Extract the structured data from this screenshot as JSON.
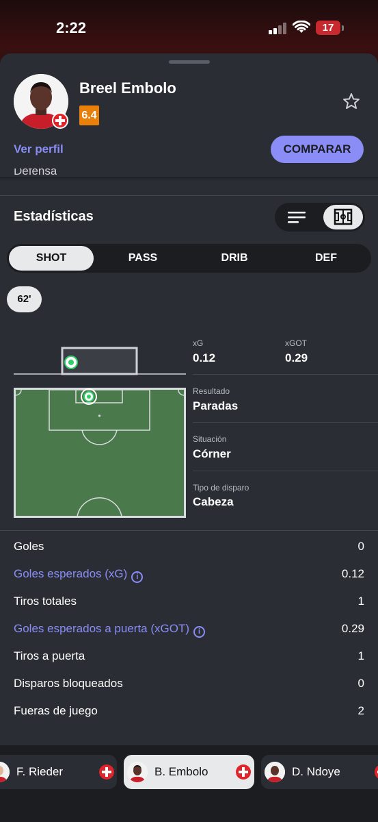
{
  "status_bar": {
    "time": "2:22",
    "battery": "17"
  },
  "player": {
    "name": "Breel Embolo",
    "rating": "6.4"
  },
  "actions": {
    "ver_perfil": "Ver perfil",
    "comparar": "COMPARAR"
  },
  "clipped_section": "Defensa",
  "stats": {
    "title": "Estadísticas",
    "tabs": [
      "SHOT",
      "PASS",
      "DRIB",
      "DEF"
    ],
    "active_tab": "SHOT",
    "minute": "62'"
  },
  "shot_details": {
    "xg_label": "xG",
    "xg_value": "0.12",
    "xgot_label": "xGOT",
    "xgot_value": "0.29",
    "resultado_label": "Resultado",
    "resultado_value": "Paradas",
    "situacion_label": "Situación",
    "situacion_value": "Córner",
    "tipo_label": "Tipo de disparo",
    "tipo_value": "Cabeza"
  },
  "stat_rows": [
    {
      "label": "Goles",
      "value": "0",
      "link": false
    },
    {
      "label": "Goles esperados (xG)",
      "value": "0.12",
      "link": true
    },
    {
      "label": "Tiros totales",
      "value": "1",
      "link": false
    },
    {
      "label": "Goles esperados a puerta (xGOT)",
      "value": "0.29",
      "link": true
    },
    {
      "label": "Tiros a puerta",
      "value": "1",
      "link": false
    },
    {
      "label": "Disparos bloqueados",
      "value": "0",
      "link": false
    },
    {
      "label": "Fueras de juego",
      "value": "2",
      "link": false
    }
  ],
  "player_switcher": [
    {
      "name": "F. Rieder",
      "active": false
    },
    {
      "name": "B. Embolo",
      "active": true
    },
    {
      "name": "D. Ndoye",
      "active": false
    }
  ],
  "colors": {
    "accent": "#8a8df6",
    "rating": "#e9800b",
    "pitch": "#4a7a4b",
    "shot_marker": "#2fd06a",
    "sheet": "#2a2d33"
  },
  "icons": {
    "star": "star-icon",
    "list_view": "list-icon",
    "pitch_view": "pitch-icon",
    "info": "info-icon",
    "flag": "switzerland-flag-icon"
  }
}
